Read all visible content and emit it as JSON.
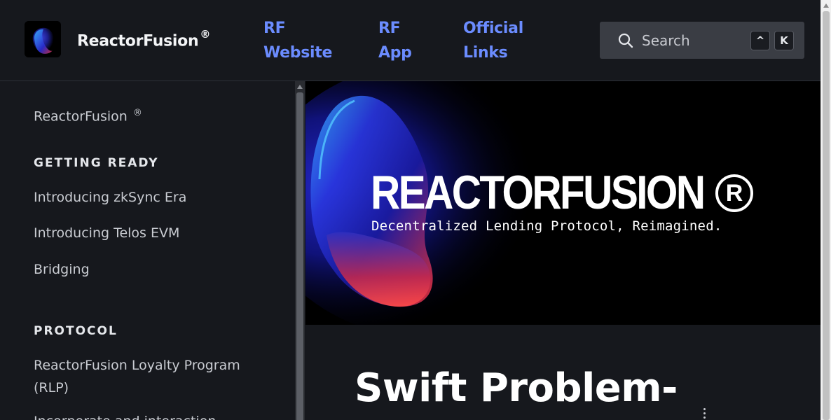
{
  "header": {
    "brand": "ReactorFusion",
    "brand_mark": "®",
    "nav": [
      {
        "label_line1": "RF",
        "label_line2": "Website"
      },
      {
        "label_line1": "RF",
        "label_line2": "App"
      },
      {
        "label_line1": "Official",
        "label_line2": "Links"
      }
    ],
    "search": {
      "label": "Search",
      "shortcut_keys": [
        "^",
        "K"
      ]
    }
  },
  "sidebar": {
    "top_item": "ReactorFusion",
    "top_item_mark": "®",
    "sections": [
      {
        "heading": "GETTING READY",
        "items": [
          "Introducing zkSync Era",
          "Introducing Telos EVM",
          "Bridging"
        ]
      },
      {
        "heading": "PROTOCOL",
        "items": [
          "ReactorFusion Loyalty Program (RLP)",
          "Incorporate and interaction"
        ]
      }
    ]
  },
  "main": {
    "hero": {
      "title": "REACTORFUSION",
      "registered_mark": "R",
      "subtitle": "Decentralized Lending Protocol, Reimagined."
    },
    "page_title": "Swift Problem-"
  },
  "icons": {
    "logo": "reactorfusion-logo-icon",
    "search": "search-icon",
    "more": "more-vertical-icon"
  },
  "colors": {
    "background": "#16181d",
    "link": "#6b8cff",
    "search_bg": "#3a3d44"
  }
}
